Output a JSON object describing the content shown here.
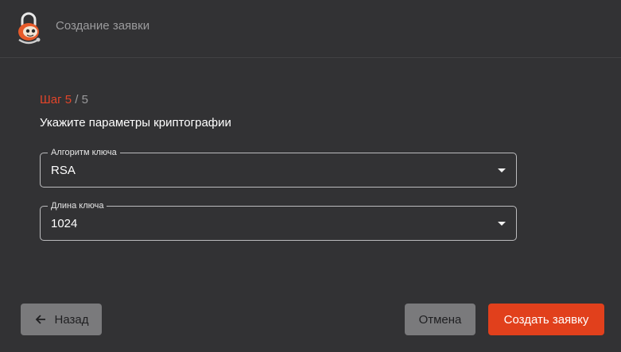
{
  "header": {
    "title": "Создание заявки",
    "logo_icon": "mascot-logo-icon"
  },
  "step": {
    "label": "Шаг",
    "current": "5",
    "separator": "/",
    "total": "5"
  },
  "subtitle": "Укажите параметры криптографии",
  "fields": {
    "algorithm": {
      "label": "Алгоритм ключа",
      "value": "RSA"
    },
    "length": {
      "label": "Длина ключа",
      "value": "1024"
    }
  },
  "buttons": {
    "back": "Назад",
    "cancel": "Отмена",
    "create": "Создать заявку"
  },
  "colors": {
    "background": "#323234",
    "accent": "#e1401c",
    "secondary_button": "#7a7a7c",
    "muted_text": "#9b9b9d"
  }
}
